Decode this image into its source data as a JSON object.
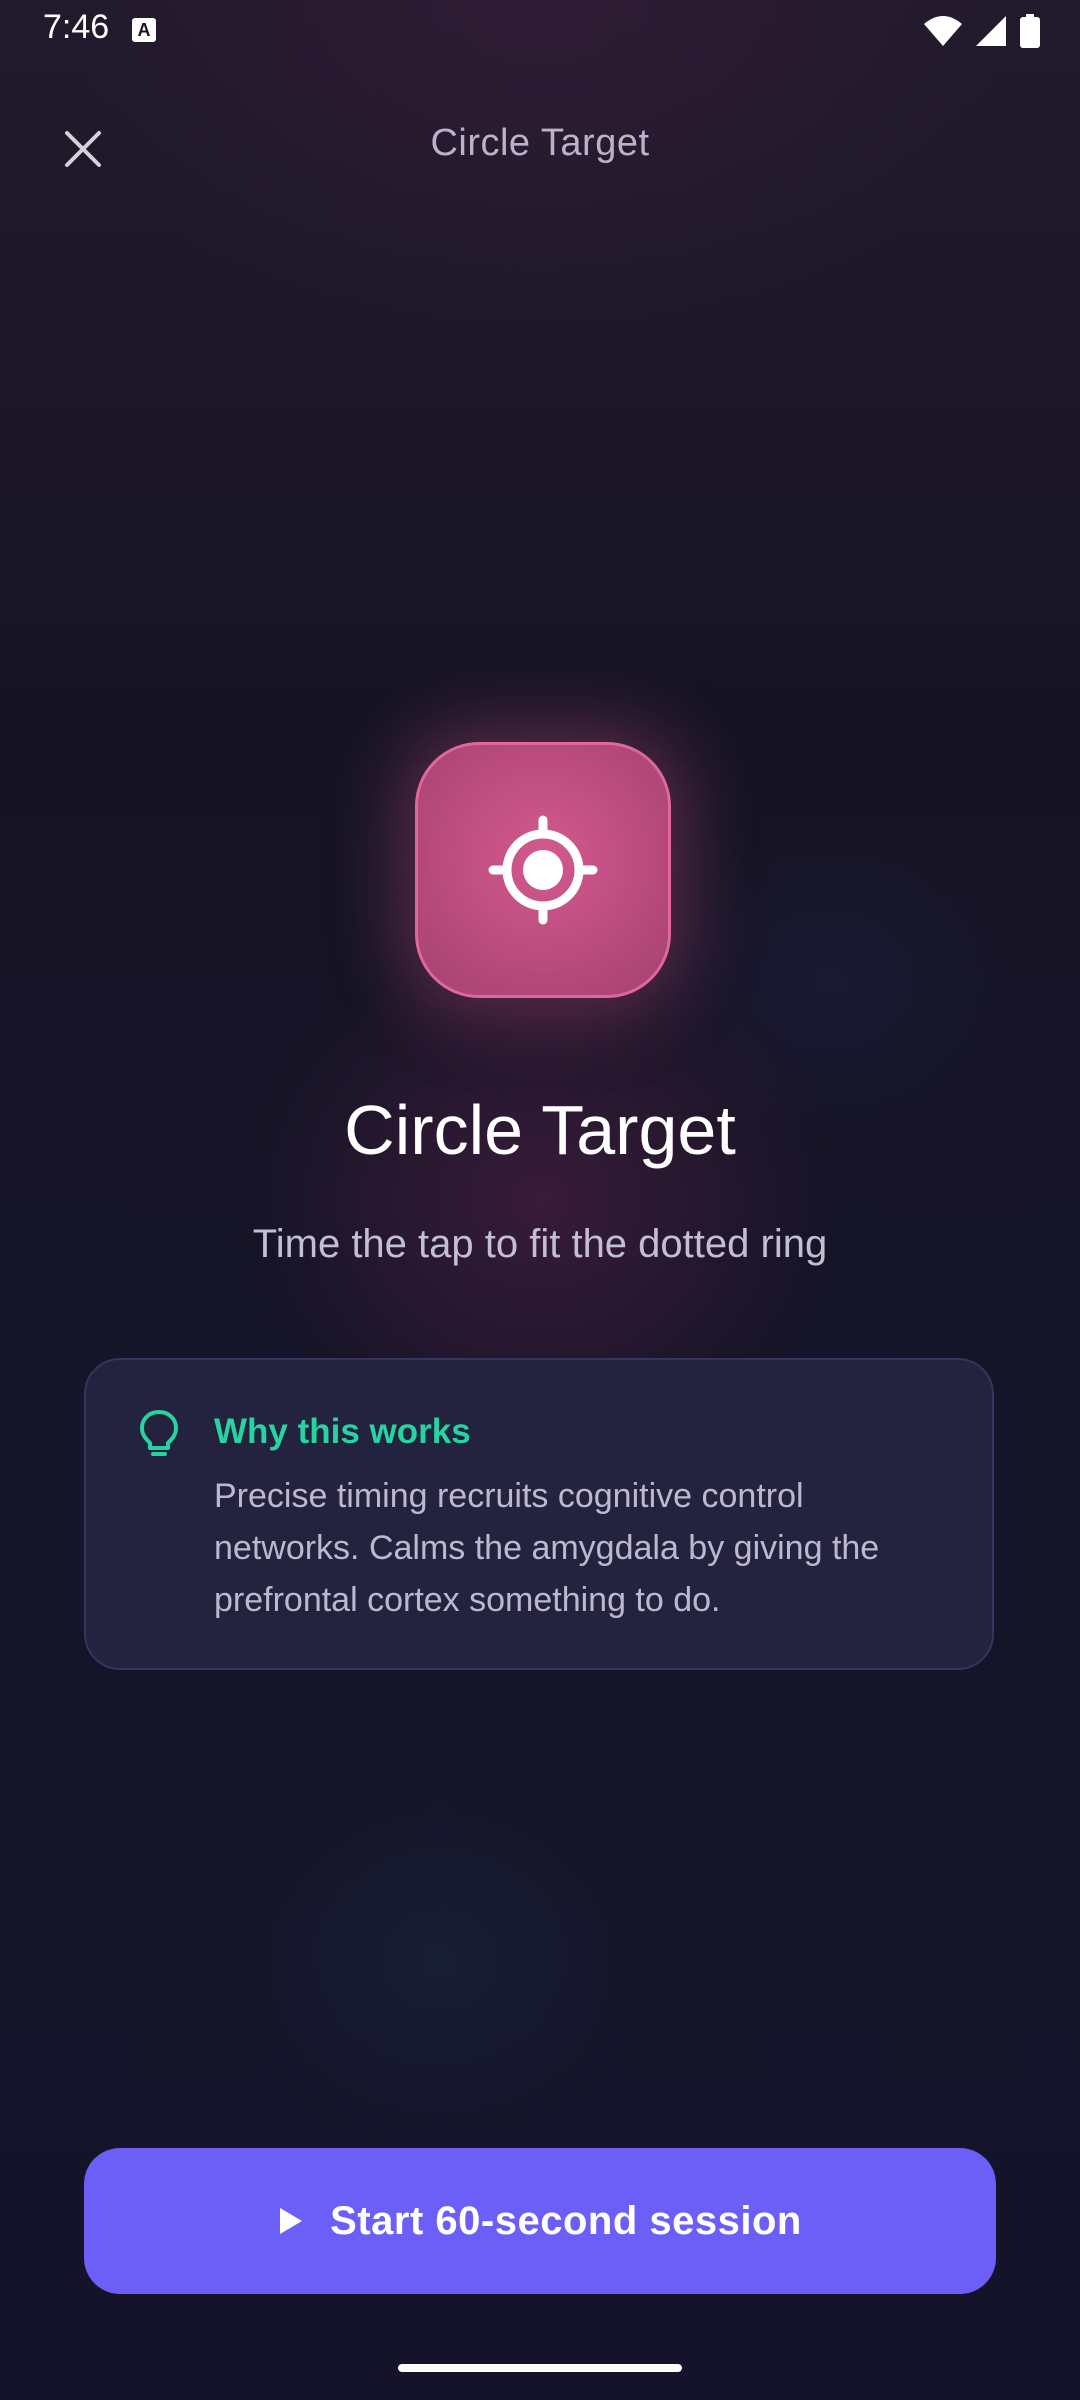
{
  "status_bar": {
    "time": "7:46",
    "notification_icon": "a-keyboard-icon",
    "icons": [
      "wifi-icon",
      "signal-icon",
      "battery-icon"
    ]
  },
  "header": {
    "close_icon": "close-icon",
    "title": "Circle Target"
  },
  "hero": {
    "icon": "target-icon",
    "icon_color": "#c8538a",
    "title": "Circle Target",
    "subtitle": "Time the tap to fit the dotted ring"
  },
  "info_card": {
    "icon": "lightbulb-icon",
    "heading": "Why this works",
    "body": "Precise timing recruits cognitive control networks. Calms the amygdala by giving the prefrontal cortex something to do.",
    "accent_color": "#27d3a0"
  },
  "start_button": {
    "icon": "play-icon",
    "label": "Start 60-second session",
    "color": "#6c5ff7"
  }
}
